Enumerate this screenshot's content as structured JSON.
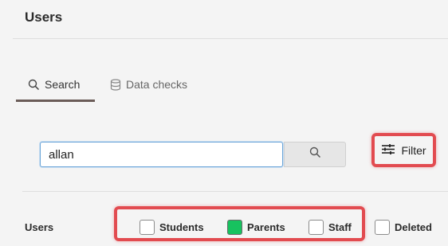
{
  "page": {
    "title": "Users"
  },
  "tabs": [
    {
      "label": "Search",
      "icon": "search-icon",
      "active": true
    },
    {
      "label": "Data checks",
      "icon": "database-icon",
      "active": false
    }
  ],
  "search": {
    "value": "allan",
    "button_icon": "search-icon"
  },
  "filter": {
    "label": "Filter",
    "icon": "sliders-icon"
  },
  "users_filter": {
    "label": "Users",
    "options": [
      {
        "label": "Students",
        "checked": false
      },
      {
        "label": "Parents",
        "checked": true
      },
      {
        "label": "Staff",
        "checked": false
      },
      {
        "label": "Deleted",
        "checked": false
      }
    ]
  },
  "colors": {
    "highlight": "#e24b50",
    "checked": "#17c25f",
    "tab_underline": "#6b5c58"
  }
}
